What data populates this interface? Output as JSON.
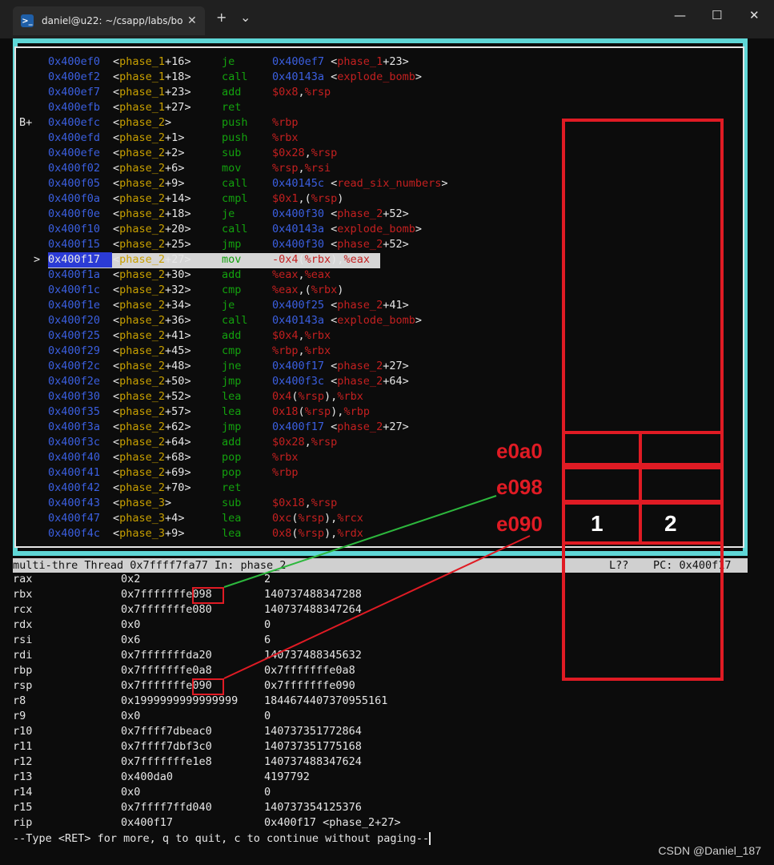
{
  "window": {
    "tab_title": "daniel@u22: ~/csapp/labs/bo",
    "tab_icon": "terminal-icon",
    "close_glyph": "✕",
    "new_tab_glyph": "+",
    "dropdown_glyph": "⌄",
    "minimize_glyph": "—",
    "maximize_glyph": "☐",
    "window_close_glyph": "✕"
  },
  "asm": [
    {
      "mark": "",
      "addr": "0x400ef0",
      "sym": "phase_1",
      "off": "+16",
      "mn": "je",
      "ops": [
        [
          "adr",
          "0x400ef7"
        ],
        [
          "txt",
          " <"
        ],
        [
          "fnr",
          "phase_1"
        ],
        [
          "txt",
          "+23>"
        ]
      ]
    },
    {
      "mark": "",
      "addr": "0x400ef2",
      "sym": "phase_1",
      "off": "+18",
      "mn": "call",
      "ops": [
        [
          "adr",
          "0x40143a"
        ],
        [
          "txt",
          " <"
        ],
        [
          "fnr",
          "explode_bomb"
        ],
        [
          "txt",
          ">"
        ]
      ]
    },
    {
      "mark": "",
      "addr": "0x400ef7",
      "sym": "phase_1",
      "off": "+23",
      "mn": "add",
      "ops": [
        [
          "imm",
          "$0x8"
        ],
        [
          "txt",
          ","
        ],
        [
          "reg",
          "%rsp"
        ]
      ]
    },
    {
      "mark": "",
      "addr": "0x400efb",
      "sym": "phase_1",
      "off": "+27",
      "mn": "ret",
      "ops": []
    },
    {
      "mark": "B+",
      "addr": "0x400efc",
      "sym": "phase_2",
      "off": "",
      "mn": "push",
      "ops": [
        [
          "reg",
          "%rbp"
        ]
      ]
    },
    {
      "mark": "",
      "addr": "0x400efd",
      "sym": "phase_2",
      "off": "+1",
      "mn": "push",
      "ops": [
        [
          "reg",
          "%rbx"
        ]
      ]
    },
    {
      "mark": "",
      "addr": "0x400efe",
      "sym": "phase_2",
      "off": "+2",
      "mn": "sub",
      "ops": [
        [
          "imm",
          "$0x28"
        ],
        [
          "txt",
          ","
        ],
        [
          "reg",
          "%rsp"
        ]
      ]
    },
    {
      "mark": "",
      "addr": "0x400f02",
      "sym": "phase_2",
      "off": "+6",
      "mn": "mov",
      "ops": [
        [
          "reg",
          "%rsp"
        ],
        [
          "txt",
          ","
        ],
        [
          "reg",
          "%rsi"
        ]
      ]
    },
    {
      "mark": "",
      "addr": "0x400f05",
      "sym": "phase_2",
      "off": "+9",
      "mn": "call",
      "ops": [
        [
          "adr",
          "0x40145c"
        ],
        [
          "txt",
          " <"
        ],
        [
          "fnr",
          "read_six_numbers"
        ],
        [
          "txt",
          ">"
        ]
      ]
    },
    {
      "mark": "",
      "addr": "0x400f0a",
      "sym": "phase_2",
      "off": "+14",
      "mn": "cmpl",
      "ops": [
        [
          "imm",
          "$0x1"
        ],
        [
          "txt",
          ",("
        ],
        [
          "reg",
          "%rsp"
        ],
        [
          "txt",
          ")"
        ]
      ]
    },
    {
      "mark": "",
      "addr": "0x400f0e",
      "sym": "phase_2",
      "off": "+18",
      "mn": "je",
      "ops": [
        [
          "adr",
          "0x400f30"
        ],
        [
          "txt",
          " <"
        ],
        [
          "fnr",
          "phase_2"
        ],
        [
          "txt",
          "+52>"
        ]
      ]
    },
    {
      "mark": "",
      "addr": "0x400f10",
      "sym": "phase_2",
      "off": "+20",
      "mn": "call",
      "ops": [
        [
          "adr",
          "0x40143a"
        ],
        [
          "txt",
          " <"
        ],
        [
          "fnr",
          "explode_bomb"
        ],
        [
          "txt",
          ">"
        ]
      ]
    },
    {
      "mark": "",
      "addr": "0x400f15",
      "sym": "phase_2",
      "off": "+25",
      "mn": "jmp",
      "ops": [
        [
          "adr",
          "0x400f30"
        ],
        [
          "txt",
          " <"
        ],
        [
          "fnr",
          "phase_2"
        ],
        [
          "txt",
          "+52>"
        ]
      ]
    },
    {
      "mark": ">",
      "addr": "0x400f17",
      "sym": "phase_2",
      "off": "+27",
      "mn": "mov",
      "ops": [
        [
          "imm",
          "-0x4"
        ],
        [
          "txt",
          "("
        ],
        [
          "reg",
          "%rbx"
        ],
        [
          "txt",
          "),"
        ],
        [
          "reg",
          "%eax"
        ]
      ],
      "current": true
    },
    {
      "mark": "",
      "addr": "0x400f1a",
      "sym": "phase_2",
      "off": "+30",
      "mn": "add",
      "ops": [
        [
          "reg",
          "%eax"
        ],
        [
          "txt",
          ","
        ],
        [
          "reg",
          "%eax"
        ]
      ]
    },
    {
      "mark": "",
      "addr": "0x400f1c",
      "sym": "phase_2",
      "off": "+32",
      "mn": "cmp",
      "ops": [
        [
          "reg",
          "%eax"
        ],
        [
          "txt",
          ",("
        ],
        [
          "reg",
          "%rbx"
        ],
        [
          "txt",
          ")"
        ]
      ]
    },
    {
      "mark": "",
      "addr": "0x400f1e",
      "sym": "phase_2",
      "off": "+34",
      "mn": "je",
      "ops": [
        [
          "adr",
          "0x400f25"
        ],
        [
          "txt",
          " <"
        ],
        [
          "fnr",
          "phase_2"
        ],
        [
          "txt",
          "+41>"
        ]
      ]
    },
    {
      "mark": "",
      "addr": "0x400f20",
      "sym": "phase_2",
      "off": "+36",
      "mn": "call",
      "ops": [
        [
          "adr",
          "0x40143a"
        ],
        [
          "txt",
          " <"
        ],
        [
          "fnr",
          "explode_bomb"
        ],
        [
          "txt",
          ">"
        ]
      ]
    },
    {
      "mark": "",
      "addr": "0x400f25",
      "sym": "phase_2",
      "off": "+41",
      "mn": "add",
      "ops": [
        [
          "imm",
          "$0x4"
        ],
        [
          "txt",
          ","
        ],
        [
          "reg",
          "%rbx"
        ]
      ]
    },
    {
      "mark": "",
      "addr": "0x400f29",
      "sym": "phase_2",
      "off": "+45",
      "mn": "cmp",
      "ops": [
        [
          "reg",
          "%rbp"
        ],
        [
          "txt",
          ","
        ],
        [
          "reg",
          "%rbx"
        ]
      ]
    },
    {
      "mark": "",
      "addr": "0x400f2c",
      "sym": "phase_2",
      "off": "+48",
      "mn": "jne",
      "ops": [
        [
          "adr",
          "0x400f17"
        ],
        [
          "txt",
          " <"
        ],
        [
          "fnr",
          "phase_2"
        ],
        [
          "txt",
          "+27>"
        ]
      ]
    },
    {
      "mark": "",
      "addr": "0x400f2e",
      "sym": "phase_2",
      "off": "+50",
      "mn": "jmp",
      "ops": [
        [
          "adr",
          "0x400f3c"
        ],
        [
          "txt",
          " <"
        ],
        [
          "fnr",
          "phase_2"
        ],
        [
          "txt",
          "+64>"
        ]
      ]
    },
    {
      "mark": "",
      "addr": "0x400f30",
      "sym": "phase_2",
      "off": "+52",
      "mn": "lea",
      "ops": [
        [
          "imm",
          "0x4"
        ],
        [
          "txt",
          "("
        ],
        [
          "reg",
          "%rsp"
        ],
        [
          "txt",
          "),"
        ],
        [
          "reg",
          "%rbx"
        ]
      ]
    },
    {
      "mark": "",
      "addr": "0x400f35",
      "sym": "phase_2",
      "off": "+57",
      "mn": "lea",
      "ops": [
        [
          "imm",
          "0x18"
        ],
        [
          "txt",
          "("
        ],
        [
          "reg",
          "%rsp"
        ],
        [
          "txt",
          "),"
        ],
        [
          "reg",
          "%rbp"
        ]
      ]
    },
    {
      "mark": "",
      "addr": "0x400f3a",
      "sym": "phase_2",
      "off": "+62",
      "mn": "jmp",
      "ops": [
        [
          "adr",
          "0x400f17"
        ],
        [
          "txt",
          " <"
        ],
        [
          "fnr",
          "phase_2"
        ],
        [
          "txt",
          "+27>"
        ]
      ]
    },
    {
      "mark": "",
      "addr": "0x400f3c",
      "sym": "phase_2",
      "off": "+64",
      "mn": "add",
      "ops": [
        [
          "imm",
          "$0x28"
        ],
        [
          "txt",
          ","
        ],
        [
          "reg",
          "%rsp"
        ]
      ]
    },
    {
      "mark": "",
      "addr": "0x400f40",
      "sym": "phase_2",
      "off": "+68",
      "mn": "pop",
      "ops": [
        [
          "reg",
          "%rbx"
        ]
      ]
    },
    {
      "mark": "",
      "addr": "0x400f41",
      "sym": "phase_2",
      "off": "+69",
      "mn": "pop",
      "ops": [
        [
          "reg",
          "%rbp"
        ]
      ]
    },
    {
      "mark": "",
      "addr": "0x400f42",
      "sym": "phase_2",
      "off": "+70",
      "mn": "ret",
      "ops": []
    },
    {
      "mark": "",
      "addr": "0x400f43",
      "sym": "phase_3",
      "off": "",
      "mn": "sub",
      "ops": [
        [
          "imm",
          "$0x18"
        ],
        [
          "txt",
          ","
        ],
        [
          "reg",
          "%rsp"
        ]
      ]
    },
    {
      "mark": "",
      "addr": "0x400f47",
      "sym": "phase_3",
      "off": "+4",
      "mn": "lea",
      "ops": [
        [
          "imm",
          "0xc"
        ],
        [
          "txt",
          "("
        ],
        [
          "reg",
          "%rsp"
        ],
        [
          "txt",
          "),"
        ],
        [
          "reg",
          "%rcx"
        ]
      ]
    },
    {
      "mark": "",
      "addr": "0x400f4c",
      "sym": "phase_3",
      "off": "+9",
      "mn": "lea",
      "ops": [
        [
          "imm",
          "0x8"
        ],
        [
          "txt",
          "("
        ],
        [
          "reg",
          "%rsp"
        ],
        [
          "txt",
          "),"
        ],
        [
          "reg",
          "%rdx"
        ]
      ]
    }
  ],
  "status": {
    "left": "multi-thre Thread 0x7ffff7fa77 In: phase_2",
    "line": "L??",
    "pc": "PC: 0x400f17"
  },
  "registers": [
    {
      "name": "rax",
      "hex": "0x2",
      "val": "2"
    },
    {
      "name": "rbx",
      "hex": "0x7fffffffe098",
      "val": "140737488347288"
    },
    {
      "name": "rcx",
      "hex": "0x7fffffffe080",
      "val": "140737488347264"
    },
    {
      "name": "rdx",
      "hex": "0x0",
      "val": "0"
    },
    {
      "name": "rsi",
      "hex": "0x6",
      "val": "6"
    },
    {
      "name": "rdi",
      "hex": "0x7fffffffda20",
      "val": "140737488345632"
    },
    {
      "name": "rbp",
      "hex": "0x7fffffffe0a8",
      "val": "0x7fffffffe0a8"
    },
    {
      "name": "rsp",
      "hex": "0x7fffffffe090",
      "val": "0x7fffffffe090"
    },
    {
      "name": "r8",
      "hex": "0x1999999999999999",
      "val": "1844674407370955161"
    },
    {
      "name": "r9",
      "hex": "0x0",
      "val": "0"
    },
    {
      "name": "r10",
      "hex": "0x7ffff7dbeac0",
      "val": "140737351772864"
    },
    {
      "name": "r11",
      "hex": "0x7ffff7dbf3c0",
      "val": "140737351775168"
    },
    {
      "name": "r12",
      "hex": "0x7fffffffe1e8",
      "val": "140737488347624"
    },
    {
      "name": "r13",
      "hex": "0x400da0",
      "val": "4197792"
    },
    {
      "name": "r14",
      "hex": "0x0",
      "val": "0"
    },
    {
      "name": "r15",
      "hex": "0x7ffff7ffd040",
      "val": "140737354125376"
    },
    {
      "name": "rip",
      "hex": "0x400f17",
      "val": "0x400f17 <phase_2+27>"
    }
  ],
  "prompt": "--Type <RET> for more, q to quit, c to continue without paging--",
  "annotations": {
    "labels": [
      "e0a0",
      "e098",
      "e090"
    ],
    "cells": [
      "1",
      "2"
    ]
  },
  "watermark": "CSDN @Daniel_187",
  "colors": {
    "frame": "#5fd7d7",
    "address": "#3b5fe0",
    "symbol": "#c8a000",
    "mnemonic": "#13a10e",
    "register": "#c42020",
    "annotation": "#e01b24",
    "arrow_green": "#2db83d"
  }
}
